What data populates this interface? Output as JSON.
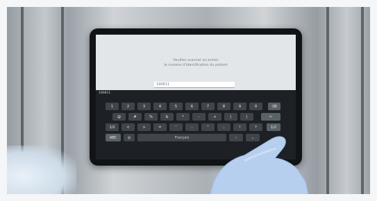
{
  "prompt": {
    "line1": "Veuillez scanner ou entrer",
    "line2": "le numéro d'identification du patient"
  },
  "input": {
    "value": "190811"
  },
  "keyboard": {
    "field_label": "190811",
    "row1": [
      "1",
      "2",
      "3",
      "4",
      "5",
      "6",
      "7",
      "8",
      "9",
      "0"
    ],
    "backspace_icon": "backspace-icon",
    "row2": [
      "@",
      "#",
      "%",
      "&",
      "*",
      "-",
      "+",
      "(",
      ")"
    ],
    "enter_icon": "enter-icon",
    "row3": [
      "1/2",
      "<",
      ">",
      "=",
      "'",
      ":",
      "\"",
      ";",
      "!",
      "?"
    ],
    "row3_right": "1/2",
    "abc": "ABC",
    "language": "Français",
    "globe_icon": "globe-icon",
    "hide_icon": "hide-keyboard-icon"
  },
  "colors": {
    "glove": "#b7cfee",
    "screen_bg": "#e3e6e8",
    "keyboard_bg": "#1d2125"
  }
}
